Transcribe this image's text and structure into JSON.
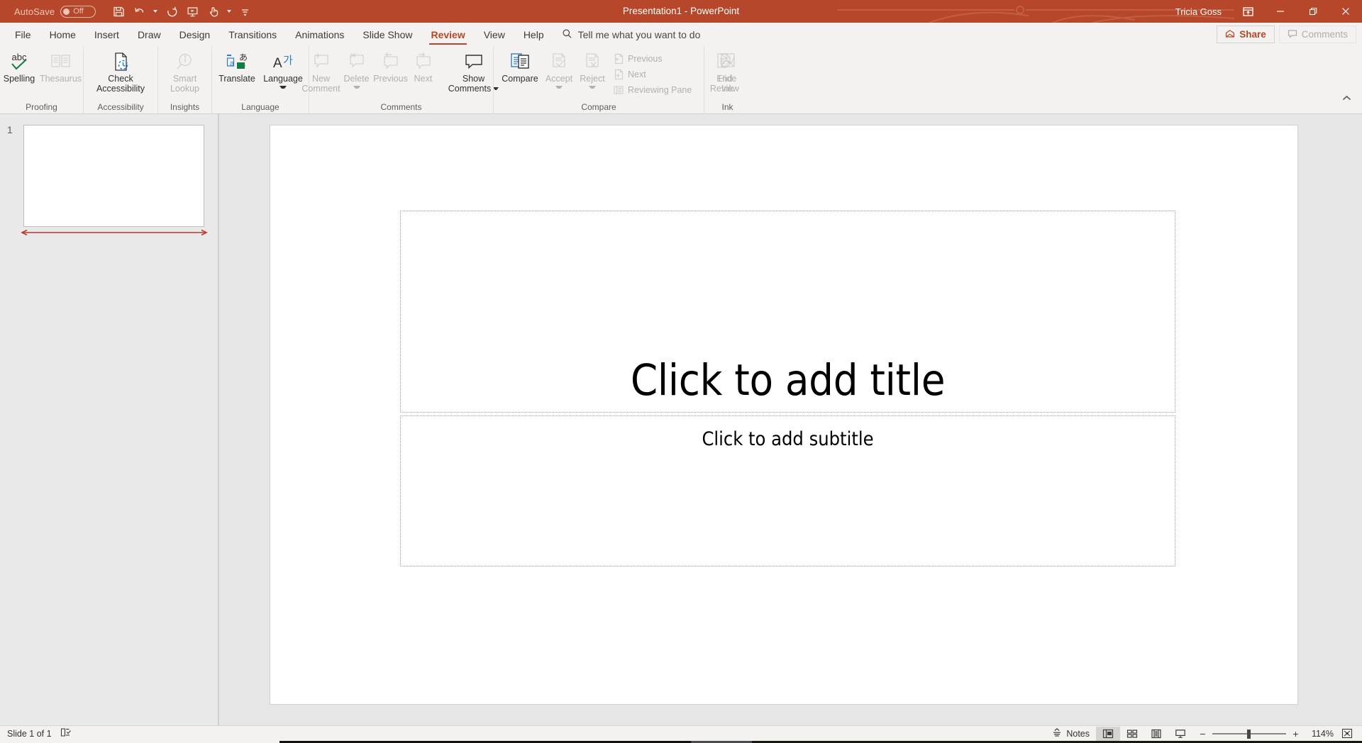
{
  "window": {
    "title": "Presentation1  -  PowerPoint",
    "user": "Tricia Goss",
    "autosave_label": "AutoSave",
    "autosave_state": "Off",
    "accent_color": "#b7472a",
    "minimize": "–",
    "restore": "❐",
    "close": "✕"
  },
  "quick_access": [
    {
      "name": "save-button",
      "label": "Save"
    },
    {
      "name": "undo-button",
      "label": "Undo"
    },
    {
      "name": "redo-button",
      "label": "Redo"
    },
    {
      "name": "start-from-beginning-button",
      "label": "Start From Beginning"
    },
    {
      "name": "touch-mode-button",
      "label": "Touch/Mouse Mode"
    },
    {
      "name": "customize-quick-access-toolbar-button",
      "label": "Customize Quick Access Toolbar"
    }
  ],
  "tabs": [
    {
      "label": "File",
      "active": false
    },
    {
      "label": "Home",
      "active": false
    },
    {
      "label": "Insert",
      "active": false
    },
    {
      "label": "Draw",
      "active": false
    },
    {
      "label": "Design",
      "active": false
    },
    {
      "label": "Transitions",
      "active": false
    },
    {
      "label": "Animations",
      "active": false
    },
    {
      "label": "Slide Show",
      "active": false
    },
    {
      "label": "Review",
      "active": true
    },
    {
      "label": "View",
      "active": false
    },
    {
      "label": "Help",
      "active": false
    }
  ],
  "search": {
    "placeholder": "Tell me what you want to do",
    "icon": "search-icon"
  },
  "header_actions": {
    "share_label": "Share",
    "comments_label": "Comments"
  },
  "ribbon": {
    "groups": [
      {
        "title": "Proofing",
        "items": [
          {
            "label": "Spelling",
            "label2": "",
            "icon": "spelling-abc-check-icon",
            "disabled": false,
            "caret": false
          },
          {
            "label": "Thesaurus",
            "label2": "",
            "icon": "thesaurus-book-icon",
            "disabled": true,
            "caret": false
          }
        ]
      },
      {
        "title": "Accessibility",
        "items": [
          {
            "label": "Check",
            "label2": "Accessibility",
            "icon": "check-accessibility-icon",
            "disabled": false,
            "caret": false
          }
        ]
      },
      {
        "title": "Insights",
        "items": [
          {
            "label": "Smart",
            "label2": "Lookup",
            "icon": "smart-lookup-icon",
            "disabled": true,
            "caret": false
          }
        ]
      },
      {
        "title": "Language",
        "items": [
          {
            "label": "Translate",
            "label2": "",
            "icon": "translate-icon",
            "disabled": false,
            "caret": false
          },
          {
            "label": "Language",
            "label2": "",
            "icon": "language-icon",
            "disabled": false,
            "caret": true
          }
        ]
      },
      {
        "title": "Comments",
        "items": [
          {
            "label": "New",
            "label2": "Comment",
            "icon": "new-comment-icon",
            "disabled": true,
            "caret": false
          },
          {
            "label": "Delete",
            "label2": "",
            "icon": "delete-comment-icon",
            "disabled": true,
            "caret": true
          },
          {
            "label": "Previous",
            "label2": "",
            "icon": "previous-comment-icon",
            "disabled": true,
            "caret": false
          },
          {
            "label": "Next",
            "label2": "",
            "icon": "next-comment-icon",
            "disabled": true,
            "caret": false
          },
          {
            "label": "Show",
            "label2": "Comments",
            "icon": "show-comments-icon",
            "disabled": false,
            "caret": true
          }
        ]
      },
      {
        "title": "Compare",
        "items": [
          {
            "label": "Compare",
            "label2": "",
            "icon": "compare-icon",
            "disabled": false,
            "caret": false
          },
          {
            "label": "Accept",
            "label2": "",
            "icon": "accept-change-icon",
            "disabled": true,
            "caret": true
          },
          {
            "label": "Reject",
            "label2": "",
            "icon": "reject-change-icon",
            "disabled": true,
            "caret": true
          }
        ],
        "small_items": [
          {
            "label": "Previous",
            "icon": "previous-change-icon",
            "disabled": true
          },
          {
            "label": "Next",
            "icon": "next-change-icon",
            "disabled": true
          },
          {
            "label": "Reviewing Pane",
            "icon": "reviewing-pane-icon",
            "disabled": true
          }
        ],
        "trailing_items": [
          {
            "label": "End",
            "label2": "Review",
            "icon": "end-review-icon",
            "disabled": true,
            "caret": false
          }
        ]
      },
      {
        "title": "Ink",
        "items": [
          {
            "label": "Hide",
            "label2": "Ink",
            "icon": "hide-ink-icon",
            "disabled": true,
            "caret": false
          }
        ]
      }
    ],
    "collapse_label": "Collapse the Ribbon"
  },
  "thumbnails": {
    "slides": [
      {
        "number": "1"
      }
    ]
  },
  "slide": {
    "title_placeholder": "Click to add title",
    "subtitle_placeholder": "Click to add subtitle"
  },
  "status": {
    "slide_counter": "Slide 1 of 1",
    "accessibility_icon": "accessibility-checker-icon",
    "notes_label": "Notes",
    "views": [
      {
        "name": "normal-view-button",
        "label": "Normal",
        "active": true
      },
      {
        "name": "slide-sorter-view-button",
        "label": "Slide Sorter",
        "active": false
      },
      {
        "name": "reading-view-button",
        "label": "Reading View",
        "active": false
      },
      {
        "name": "slide-show-button",
        "label": "Slide Show",
        "active": false
      }
    ],
    "zoom_out": "−",
    "zoom_in": "+",
    "zoom_value": "114%",
    "fit_label": "Fit slide to current window"
  }
}
